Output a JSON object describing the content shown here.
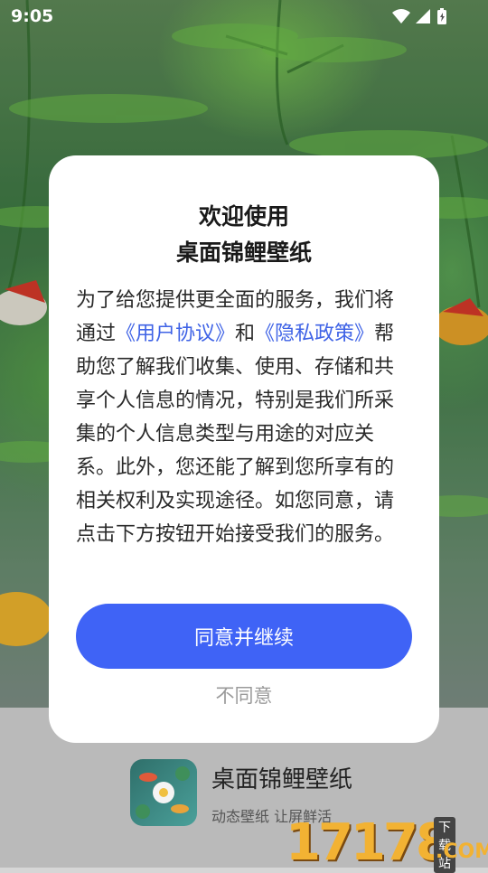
{
  "status_bar": {
    "time": "9:05",
    "icons": [
      "wifi-icon",
      "signal-icon",
      "battery-charging-icon"
    ]
  },
  "dialog": {
    "title_line1": "欢迎使用",
    "title_line2": "桌面锦鲤壁纸",
    "body_part1": "为了给您提供更全面的服务，我们将通过",
    "link_user_agreement": "《用户协议》",
    "body_part2": "和",
    "link_privacy_policy": "《隐私政策》",
    "body_part3": "帮助您了解我们收集、使用、存储和共享个人信息的情况，特别是我们所采集的个人信息类型与用途的对应关系。此外，您还能了解到您所享有的相关权利及实现途径。如您同意，请点击下方按钮开始接受我们的服务。",
    "agree_label": "同意并继续",
    "disagree_label": "不同意"
  },
  "app": {
    "name": "桌面锦鲤壁纸",
    "slogan": "动态壁纸 让屏鲜活"
  },
  "watermark": {
    "digits": "17178",
    "tag": "下载站",
    "domain": ".COM"
  },
  "colors": {
    "accent": "#3f63f6",
    "link": "#3f63e6"
  }
}
